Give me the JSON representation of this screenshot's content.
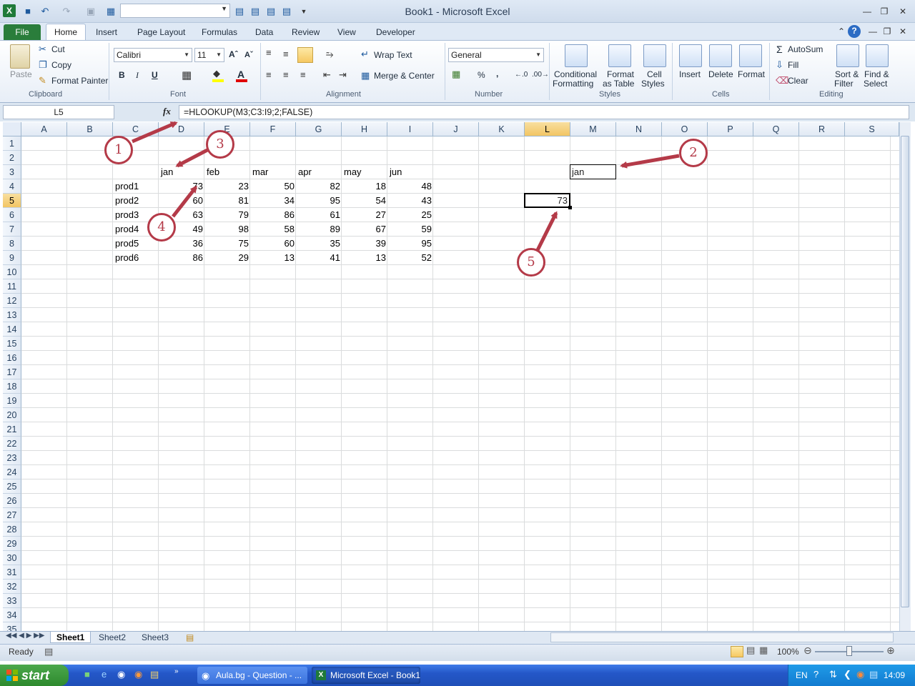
{
  "window": {
    "title": "Book1 - Microsoft Excel"
  },
  "ribbon_tabs": [
    "File",
    "Home",
    "Insert",
    "Page Layout",
    "Formulas",
    "Data",
    "Review",
    "View",
    "Developer"
  ],
  "clipboard": {
    "paste": "Paste",
    "cut": "Cut",
    "copy": "Copy",
    "format_painter": "Format Painter",
    "group": "Clipboard"
  },
  "font": {
    "name": "Calibri",
    "size": "11",
    "bold": "B",
    "italic": "I",
    "underline": "U",
    "group": "Font"
  },
  "alignment": {
    "wrap_text": "Wrap Text",
    "merge_center": "Merge & Center",
    "group": "Alignment"
  },
  "number": {
    "format": "General",
    "percent": "%",
    "comma": ",",
    "group": "Number"
  },
  "styles": {
    "conditional": "Conditional",
    "conditional2": "Formatting",
    "format_table": "Format",
    "format_table2": "as Table",
    "cell_styles": "Cell",
    "cell_styles2": "Styles",
    "group": "Styles"
  },
  "cells": {
    "insert": "Insert",
    "delete": "Delete",
    "format": "Format",
    "group": "Cells"
  },
  "editing": {
    "autosum": "AutoSum",
    "fill": "Fill",
    "clear": "Clear",
    "sort": "Sort &",
    "sort2": "Filter",
    "find": "Find &",
    "find2": "Select",
    "group": "Editing"
  },
  "formula_bar": {
    "name_box": "L5",
    "fx": "fx",
    "formula": "=HLOOKUP(M3;C3:I9;2;FALSE)"
  },
  "columns": [
    "A",
    "B",
    "C",
    "D",
    "E",
    "F",
    "G",
    "H",
    "I",
    "J",
    "K",
    "L",
    "M",
    "N",
    "O",
    "P",
    "Q",
    "R",
    "S"
  ],
  "selected_column": "L",
  "selected_row": 5,
  "rows": [
    "1",
    "2",
    "3",
    "4",
    "5",
    "6",
    "7",
    "8",
    "9",
    "10",
    "11",
    "12",
    "13",
    "14",
    "15",
    "16",
    "17",
    "18",
    "19",
    "20",
    "21",
    "22",
    "23",
    "24",
    "25",
    "26",
    "27",
    "28",
    "29",
    "30",
    "31",
    "32",
    "33",
    "34",
    "35"
  ],
  "table": {
    "headers": [
      "jan",
      "feb",
      "mar",
      "apr",
      "may",
      "jun"
    ],
    "products": [
      "prod1",
      "prod2",
      "prod3",
      "prod4",
      "prod5",
      "prod6"
    ],
    "values": [
      [
        73,
        23,
        50,
        82,
        18,
        48
      ],
      [
        60,
        81,
        34,
        95,
        54,
        43
      ],
      [
        63,
        79,
        86,
        61,
        27,
        25
      ],
      [
        49,
        98,
        58,
        89,
        67,
        59
      ],
      [
        36,
        75,
        60,
        35,
        39,
        95
      ],
      [
        86,
        29,
        13,
        41,
        13,
        52
      ]
    ]
  },
  "lookup_cell_M3": "jan",
  "result_cell_L5": "73",
  "sheets": [
    "Sheet1",
    "Sheet2",
    "Sheet3"
  ],
  "status": {
    "ready": "Ready",
    "zoom": "100%"
  },
  "taskbar": {
    "start": "start",
    "task1": "Aula.bg - Question - ...",
    "task2": "Microsoft Excel - Book1",
    "lang": "EN",
    "clock": "14:09"
  },
  "annotations": [
    "1",
    "2",
    "3",
    "4",
    "5"
  ],
  "colors": {
    "accent": "#2a7d3b",
    "annotation": "#b43a48",
    "selection": "#f2c563"
  }
}
